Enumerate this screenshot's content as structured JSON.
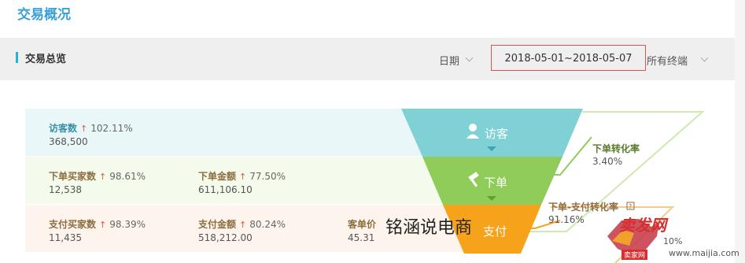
{
  "page": {
    "title": "交易概况"
  },
  "section": {
    "title": "交易总览"
  },
  "filters": {
    "date_label": "日期",
    "date_range": "2018-05-01~2018-05-07",
    "terminal": "所有终端"
  },
  "rows": {
    "visitors": {
      "label": "访客数",
      "pct": "102.11%",
      "value": "368,500"
    },
    "order_buyers": {
      "label": "下单买家数",
      "pct": "98.61%",
      "value": "12,538"
    },
    "order_amount": {
      "label": "下单金额",
      "pct": "77.50%",
      "value": "611,106.10"
    },
    "pay_buyers": {
      "label": "支付买家数",
      "pct": "98.39%",
      "value": "11,435"
    },
    "pay_amount": {
      "label": "支付金额",
      "pct": "80.24%",
      "value": "518,212.00"
    },
    "unit_price": {
      "label": "客单价",
      "value": "45.31"
    }
  },
  "funnel": {
    "stage1": "访客",
    "stage2": "下单",
    "stage3": "支付",
    "rate1_label": "下单转化率",
    "rate1_value": "3.40%",
    "rate2_label": "下单-支付转化率",
    "rate2_value": "91.16%",
    "rate3_value": "10%",
    "colors": {
      "stage1": "#7fd1d6",
      "stage2": "#8fcc5a",
      "stage3": "#f7a21b"
    }
  },
  "watermark": "铭涵说电商",
  "logo": {
    "text": "卖发网",
    "url": "www.maijia.com",
    "tag": "卖家网"
  }
}
